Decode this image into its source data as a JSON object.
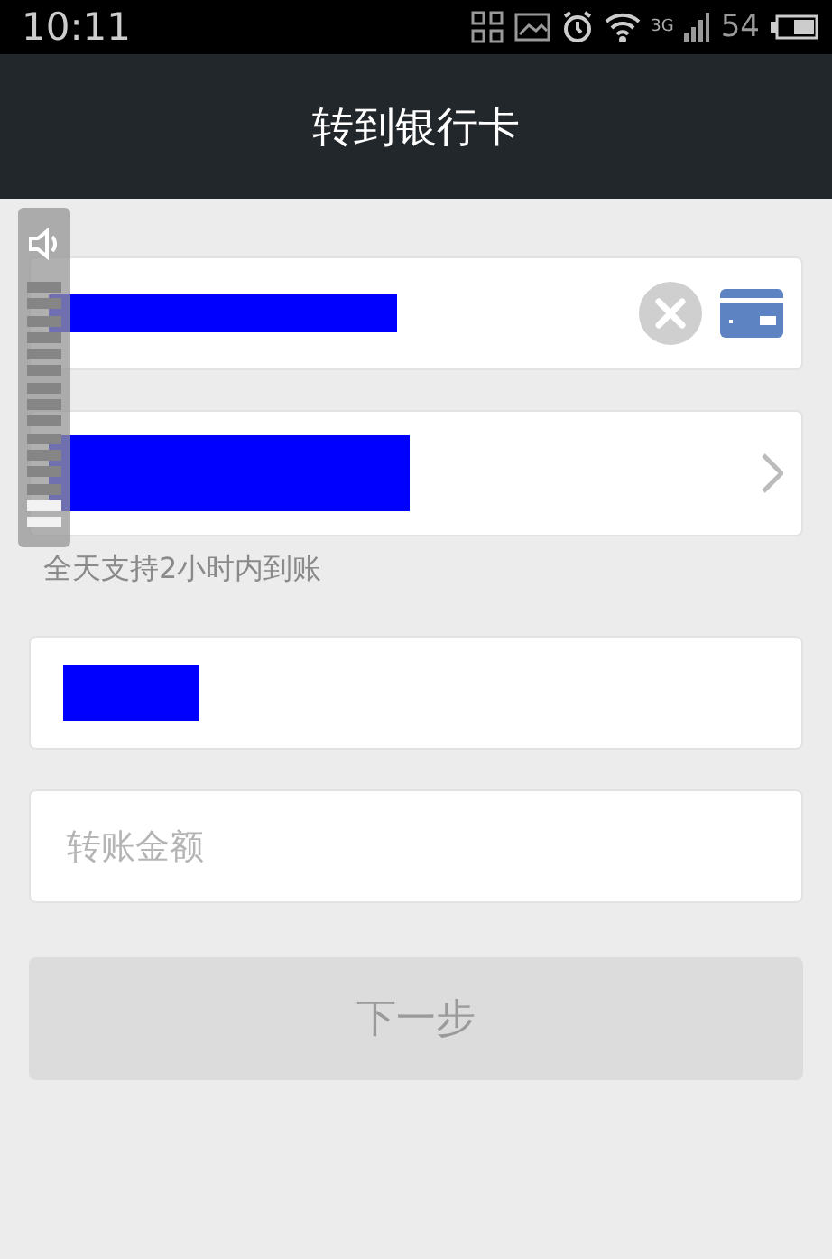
{
  "status_bar": {
    "time": "10:11",
    "network": "3G",
    "battery": "54"
  },
  "header": {
    "title": "转到银行卡"
  },
  "volume_overlay": {
    "level": 0.13
  },
  "fields": [
    {
      "kind": "card"
    },
    {
      "kind": "bank"
    },
    {
      "kind": "hint",
      "text": "全天支持2小时内到账"
    },
    {
      "kind": "name"
    },
    {
      "kind": "amount",
      "placeholder": "转账金额"
    }
  ],
  "next_button": {
    "label": "下一步",
    "disabled": true
  }
}
